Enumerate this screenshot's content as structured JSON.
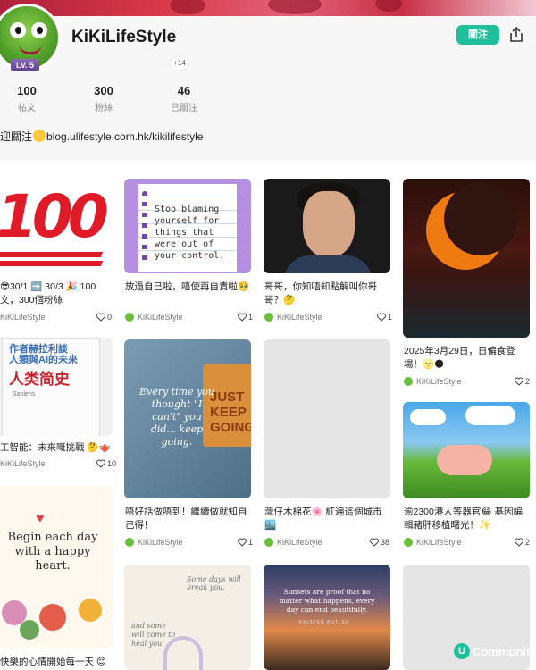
{
  "profile": {
    "username": "KiKiLifeStyle",
    "level": "LV. 5",
    "follow_label": "關注",
    "share_icon": "share-icon",
    "plus_count": "+14",
    "stats": [
      {
        "value": "100",
        "label": "帖文"
      },
      {
        "value": "300",
        "label": "粉絲"
      },
      {
        "value": "46",
        "label": "已關注"
      }
    ],
    "bio_prefix": "迎關注",
    "bio_link": "blog.ulifestyle.com.hk/kikilifestyle"
  },
  "colors": {
    "accent": "#1fbf9a",
    "like": "#444444"
  },
  "posts": [
    {
      "caption": "😎30/1 ➡️ 30/3 🎉 100文，300個粉絲",
      "author": "KiKiLifeStyle",
      "likes": "0"
    },
    {
      "caption": "放過自己啦，唔使再自責啦🥹",
      "author": "KiKiLifeStyle",
      "likes": "1"
    },
    {
      "caption": "哥哥，你知唔知點解叫你哥哥？🤔",
      "author": "KiKiLifeStyle",
      "likes": "1"
    },
    {
      "caption": "2025年3月29日，日偏食登場！🌝🌑",
      "author": "KiKiLifeStyle",
      "likes": "2"
    },
    {
      "caption": "工智能：未來嘅挑戰 🤔🫖",
      "author": "KiKiLifeStyle",
      "likes": "10"
    },
    {
      "caption": "唔好話做唔到！繼續做就知自己得！",
      "author": "KiKiLifeStyle",
      "likes": "1"
    },
    {
      "caption": "灣仔木棉花🌸 紅遍這個城市🏙️",
      "author": "KiKiLifeStyle",
      "likes": "38"
    },
    {
      "caption": "逾2300港人等器官😂 基因編輯豬肝移植曙光！✨",
      "author": "KiKiLifeStyle",
      "likes": "2"
    },
    {
      "caption": "快樂的心情開始每一天 😊",
      "author": "",
      "likes": ""
    }
  ],
  "thumbs": {
    "hundred": "100",
    "note_text": "Stop blaming yourself for things that were out of your control.",
    "portrait_alt": "",
    "book_cn1": "作者赫拉利談",
    "book_cn1b": "人類與AI的未來",
    "book_title": "人类简史",
    "book_en": "Sapiens",
    "quote": "Every time you thought \"I can't\" you did... keep going.",
    "keep": "JUST KEEP GOING",
    "begin": "Begin each day with a happy heart.",
    "bird_top": "Some days will break you,",
    "bird_side": "and some will come to heal you",
    "sunset_quote": "Sunsets are proof that no matter what happens, every day can end beautifully.",
    "sunset_author": "KRISTEN BUTLER"
  },
  "watermark": {
    "letter": "U",
    "text": "Community"
  }
}
